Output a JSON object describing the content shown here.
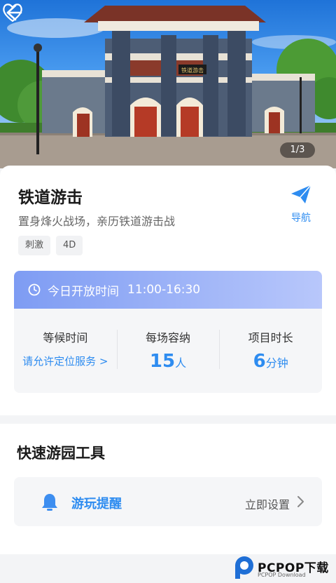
{
  "hero": {
    "image_counter": "1/3",
    "banner_text": "铁道游击"
  },
  "attraction": {
    "title": "铁道游击",
    "subtitle": "置身烽火战场，亲历铁道游击战",
    "tags": [
      "刺激",
      "4D"
    ],
    "nav_label": "导航"
  },
  "hours": {
    "label": "今日开放时间",
    "time": "11:00-16:30"
  },
  "stats": {
    "wait": {
      "label": "等候时间",
      "value": "请允许定位服务 >"
    },
    "capacity": {
      "label": "每场容纳",
      "number": "15",
      "unit": "人"
    },
    "duration": {
      "label": "项目时长",
      "number": "6",
      "unit": "分钟"
    }
  },
  "tools": {
    "section_title": "快速游园工具",
    "reminder": {
      "name": "游玩提醒",
      "action": "立即设置"
    }
  },
  "watermark": {
    "brand": "PCPOP下载",
    "sub": "PCPOP Download"
  },
  "colors": {
    "accent": "#2e8cf0",
    "hours_bar_start": "#7e9cf3",
    "hours_bar_end": "#b8c7fb"
  }
}
